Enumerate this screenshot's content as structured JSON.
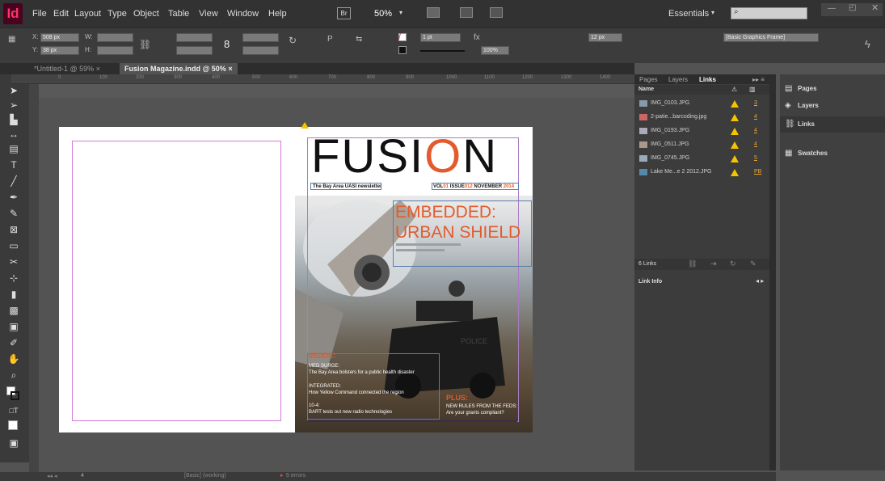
{
  "app": {
    "logo": "Id"
  },
  "menu": [
    "File",
    "Edit",
    "Layout",
    "Type",
    "Object",
    "Table",
    "View",
    "Window",
    "Help"
  ],
  "menu_extra": {
    "bridge": "Br",
    "zoom": "50%",
    "workspace": "Essentials",
    "search_placeholder": ""
  },
  "control": {
    "x": "508 px",
    "y": "38 px",
    "w_label": "W:",
    "h_label": "H:",
    "stroke": "1 pt",
    "opacity": "100%",
    "size": "12 px",
    "frame_style": "[Basic Graphics Frame]"
  },
  "tabs": [
    {
      "label": "*Untitled-1 @ 59%",
      "close": "×"
    },
    {
      "label": "Fusion Magazine.indd @ 50%",
      "close": "×"
    }
  ],
  "ruler_marks": [
    "0",
    "100",
    "200",
    "300",
    "400",
    "500",
    "600",
    "700",
    "800",
    "900",
    "1000",
    "1100",
    "1200",
    "1300",
    "1400"
  ],
  "cover": {
    "title_a": "FUSI",
    "title_o": "O",
    "title_b": "N",
    "tagline": "The Bay Area UASI newsletter",
    "issue_a": "VOL",
    "issue_b": "01",
    "issue_c": " ISSUE",
    "issue_d": "012",
    "issue_e": " NOVEMBER ",
    "issue_f": "2014",
    "headline_1": "EMBEDDED:",
    "headline_2": "URBAN SHIELD",
    "police": "POLICE",
    "inside": "INSIDE:",
    "med_surge": "MED SURGE:",
    "med_surge_text": "The Bay Area bolsters for a public health disaster",
    "integrated": "INTEGRATED:",
    "integrated_text": "How Yellow Command connected the region",
    "ten_four": "10-4:",
    "ten_four_text": "BART tests out new radio technologies",
    "plus": "PLUS:",
    "plus_1": "NEW RULES FROM THE FEDS:",
    "plus_2": "Are your grants compliant?"
  },
  "links_panel": {
    "tabs": [
      "Pages",
      "Layers",
      "Links"
    ],
    "col_name": "Name",
    "rows": [
      {
        "name": "IMG_0103.JPG",
        "page": "3"
      },
      {
        "name": "2-patie...barcoding.jpg",
        "page": "4"
      },
      {
        "name": "IMG_0193.JPG",
        "page": "4"
      },
      {
        "name": "IMG_0511.JPG",
        "page": "4"
      },
      {
        "name": "IMG_0745.JPG",
        "page": "5"
      },
      {
        "name": "Lake Me...e 2 2012.JPG",
        "page": "PB"
      }
    ],
    "count": "6 Links",
    "link_info": "Link Info"
  },
  "strip": {
    "items": [
      "Pages",
      "Layers",
      "Links",
      "Swatches"
    ]
  },
  "status": {
    "page": "4",
    "style": "[Basic] (working)",
    "errors": "5 errors"
  }
}
